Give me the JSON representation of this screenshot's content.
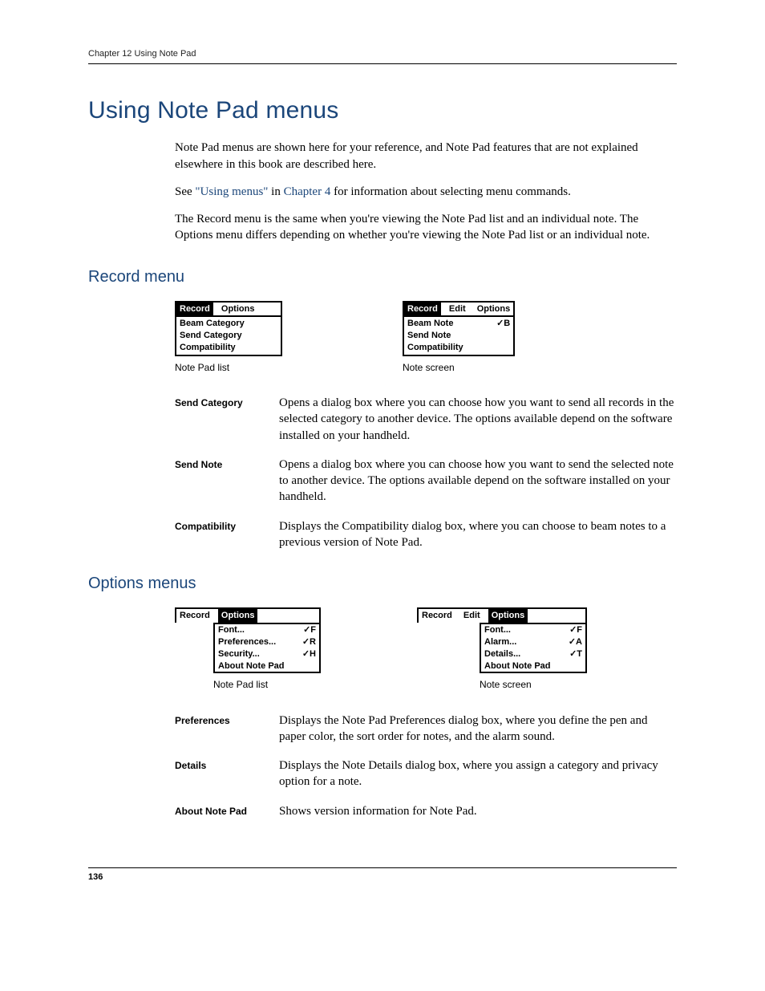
{
  "header": {
    "text": "Chapter 12   Using Note Pad"
  },
  "title": "Using Note Pad menus",
  "intro": {
    "p1": "Note Pad menus are shown here for your reference, and Note Pad features that are not explained elsewhere in this book are described here.",
    "p2_a": "See ",
    "p2_link1": "\"Using menus\"",
    "p2_b": " in ",
    "p2_link2": "Chapter 4",
    "p2_c": " for information about selecting menu commands.",
    "p3": "The Record menu is the same when you're viewing the Note Pad list and an individual note. The Options menu differs depending on whether you're viewing the Note Pad list or an individual note."
  },
  "record_menu": {
    "heading": "Record menu",
    "shot1": {
      "menubar": [
        "Record",
        "Options"
      ],
      "active_index": 0,
      "items": [
        {
          "label": "Beam Category",
          "shortcut": ""
        },
        {
          "label": "Send Category",
          "shortcut": ""
        },
        {
          "label": "Compatibility",
          "shortcut": ""
        }
      ],
      "caption": "Note Pad list"
    },
    "shot2": {
      "menubar": [
        "Record",
        "Edit",
        "Options"
      ],
      "active_index": 0,
      "items": [
        {
          "label": "Beam Note",
          "shortcut": "✓B"
        },
        {
          "label": "Send Note",
          "shortcut": ""
        },
        {
          "label": "Compatibility",
          "shortcut": ""
        }
      ],
      "caption": "Note screen"
    },
    "defs": [
      {
        "term": "Send Category",
        "desc": "Opens a dialog box where you can choose how you want to send all records in the selected category to another device. The options available depend on the software installed on your handheld."
      },
      {
        "term": "Send Note",
        "desc": "Opens a dialog box where you can choose how you want to send the selected note to another device. The options available depend on the software installed on your handheld."
      },
      {
        "term": "Compatibility",
        "desc": "Displays the Compatibility dialog box, where you can choose to beam notes to a previous version of Note Pad."
      }
    ]
  },
  "options_menus": {
    "heading": "Options menus",
    "shot1": {
      "menubar": [
        "Record",
        "Options"
      ],
      "active_index": 1,
      "items": [
        {
          "label": "Font...",
          "shortcut": "✓F"
        },
        {
          "label": "Preferences...",
          "shortcut": "✓R"
        },
        {
          "label": "Security...",
          "shortcut": "✓H"
        },
        {
          "label": "About Note Pad",
          "shortcut": ""
        }
      ],
      "caption": "Note Pad list"
    },
    "shot2": {
      "menubar": [
        "Record",
        "Edit",
        "Options"
      ],
      "active_index": 2,
      "items": [
        {
          "label": "Font...",
          "shortcut": "✓F"
        },
        {
          "label": "Alarm...",
          "shortcut": "✓A"
        },
        {
          "label": "Details...",
          "shortcut": "✓T"
        },
        {
          "label": "About Note Pad",
          "shortcut": ""
        }
      ],
      "caption": "Note screen"
    },
    "defs": [
      {
        "term": "Preferences",
        "desc": "Displays the Note Pad Preferences dialog box, where you define the pen and paper color, the sort order for notes, and the alarm sound."
      },
      {
        "term": "Details",
        "desc": "Displays the Note Details dialog box, where you assign a category and privacy option for a note."
      },
      {
        "term": "About Note Pad",
        "desc": "Shows version information for Note Pad."
      }
    ]
  },
  "page_number": "136"
}
